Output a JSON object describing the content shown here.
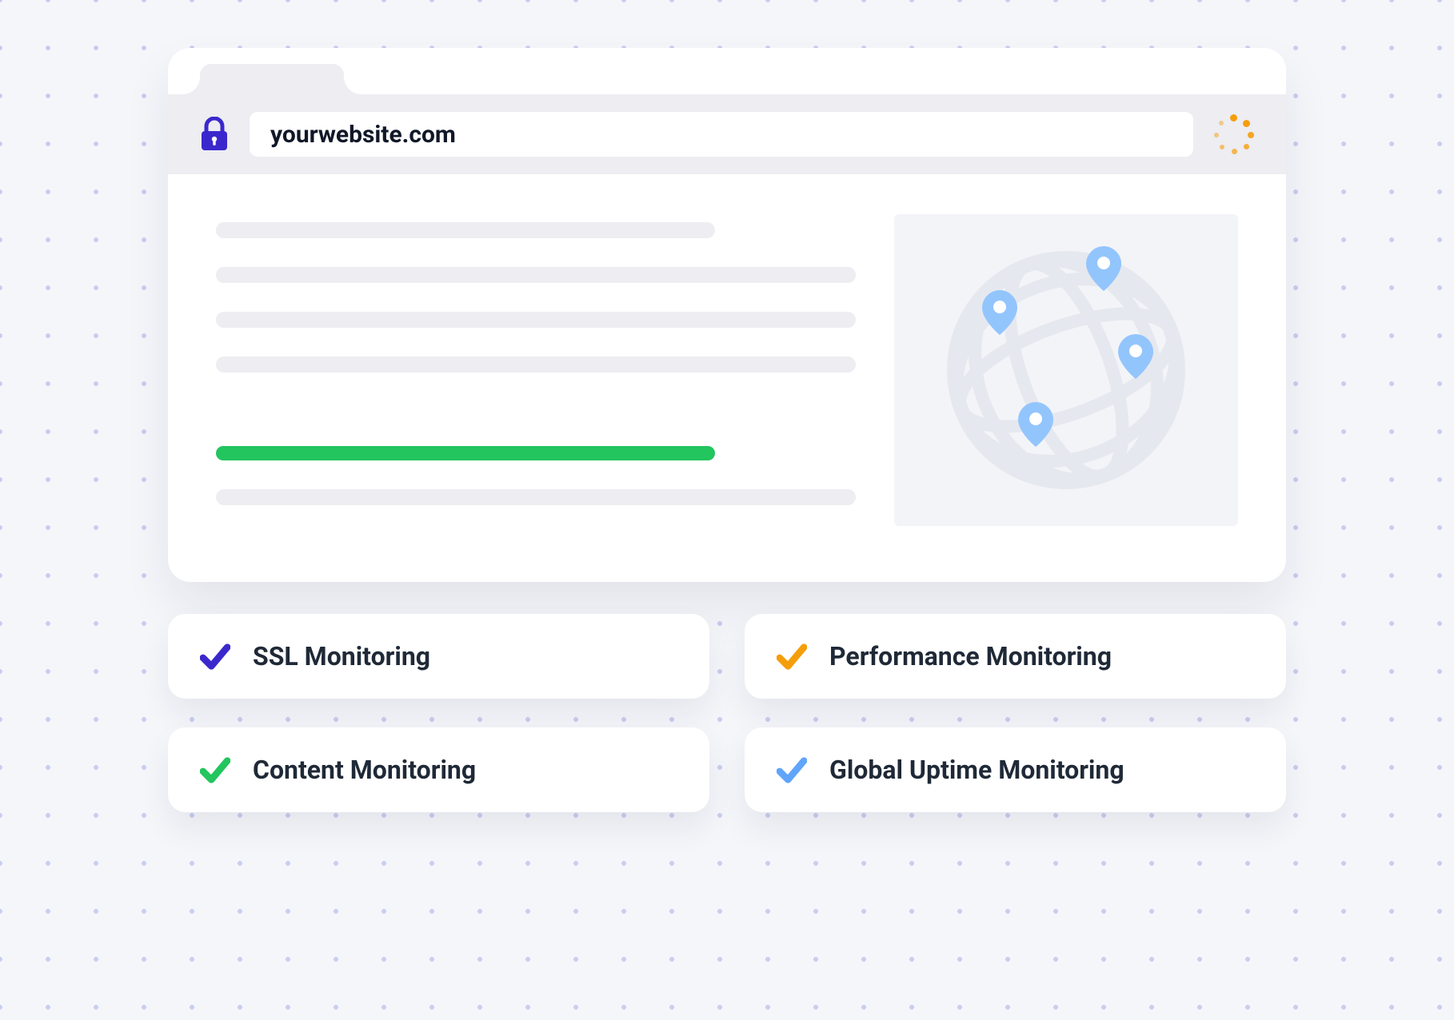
{
  "browser": {
    "url": "yourwebsite.com"
  },
  "features": [
    {
      "label": "SSL Monitoring",
      "color": "#3b28cc"
    },
    {
      "label": "Performance Monitoring",
      "color": "#f59e0b"
    },
    {
      "label": "Content Monitoring",
      "color": "#22c55e"
    },
    {
      "label": "Global Uptime Monitoring",
      "color": "#60a5fa"
    }
  ],
  "colors": {
    "lock": "#3b28cc",
    "spinner": "#f59e0b",
    "highlight": "#22c55e",
    "pin": "#93c5fd",
    "globe": "#e6e8ef"
  }
}
